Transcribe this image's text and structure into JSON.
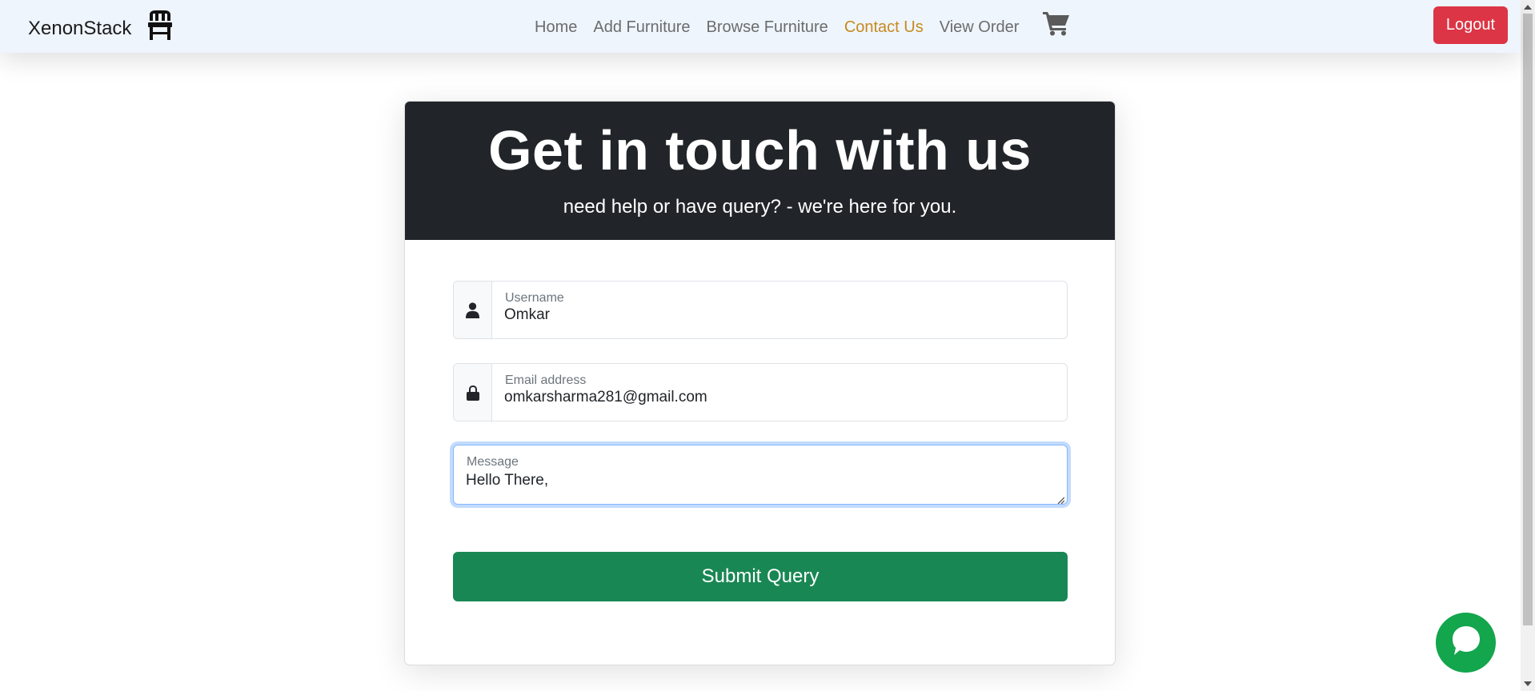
{
  "navbar": {
    "brand": "XenonStack",
    "brand_icon": "chair-icon",
    "links": [
      {
        "label": "Home",
        "active": false
      },
      {
        "label": "Add Furniture",
        "active": false
      },
      {
        "label": "Browse Furniture",
        "active": false
      },
      {
        "label": "Contact Us",
        "active": true
      },
      {
        "label": "View Order",
        "active": false
      }
    ],
    "cart_icon": "cart-icon",
    "logout_label": "Logout"
  },
  "contact": {
    "title": "Get in touch with us",
    "subtitle": "need help or have query? - we're here for you.",
    "username": {
      "label": "Username",
      "value": "Omkar",
      "icon": "user-icon"
    },
    "email": {
      "label": "Email address",
      "value": "omkarsharma281@gmail.com",
      "icon": "lock-icon"
    },
    "message": {
      "label": "Message",
      "value": "Hello There,"
    },
    "submit_label": "Submit Query"
  },
  "chat": {
    "icon": "chat-bubble-icon"
  },
  "colors": {
    "navbar_bg": "#eef5fd",
    "active_link": "#c78a1e",
    "logout": "#dc3545",
    "header_bg": "#212529",
    "submit": "#198754",
    "chat": "#13a64d"
  }
}
